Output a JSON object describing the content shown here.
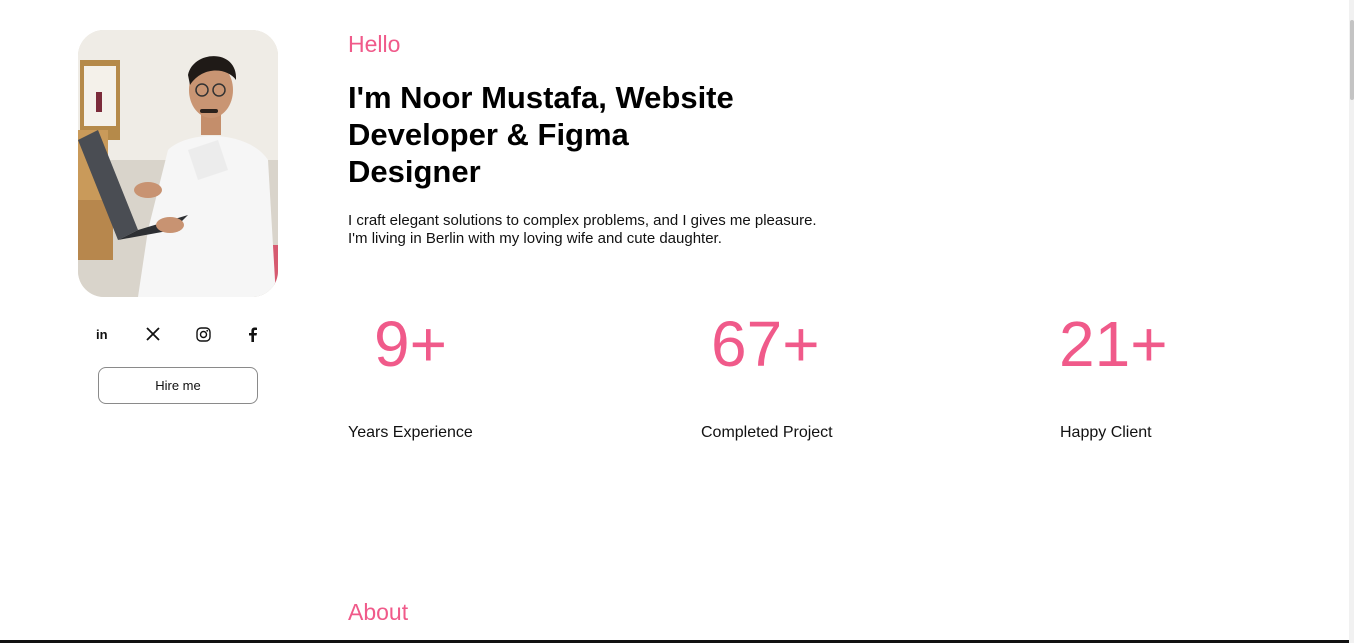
{
  "profile": {
    "photo_alt": "Noor Mustafa working on a laptop",
    "socials": [
      {
        "name": "linkedin",
        "glyph": "in"
      },
      {
        "name": "x",
        "glyph": "X"
      },
      {
        "name": "instagram",
        "glyph": ""
      },
      {
        "name": "facebook",
        "glyph": "f"
      }
    ],
    "hire_label": "Hire me"
  },
  "hero": {
    "greeting": "Hello",
    "headline": "I'm Noor Mustafa, Website Developer & Figma Designer",
    "intro": "I craft elegant solutions to complex problems, and I gives me pleasure. I'm living in Berlin with my loving wife and cute daughter."
  },
  "stats": [
    {
      "value": "9+",
      "label": "Years Experience"
    },
    {
      "value": "67+",
      "label": "Completed Project"
    },
    {
      "value": "21+",
      "label": "Happy Client"
    }
  ],
  "sections": {
    "about_title": "About"
  },
  "colors": {
    "accent": "#f05a8a",
    "text": "#111111",
    "background": "#ffffff"
  }
}
